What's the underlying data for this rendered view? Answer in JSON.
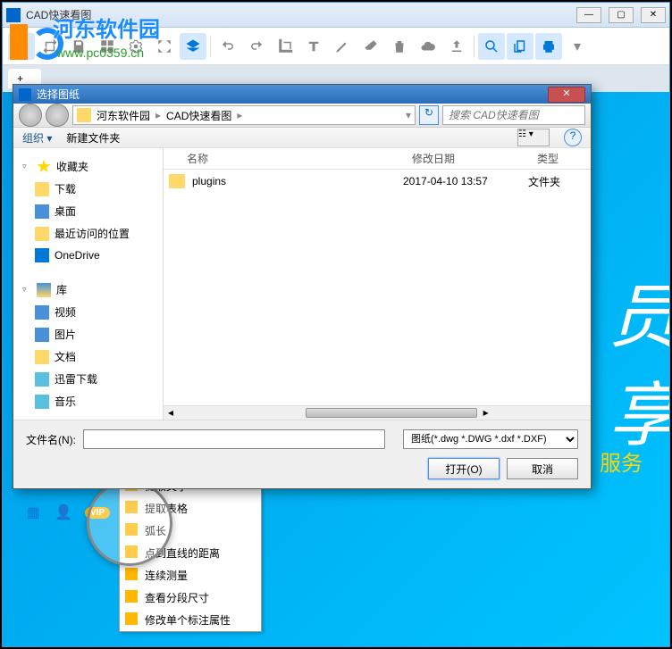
{
  "app": {
    "title": "CAD快速看图",
    "watermark_text": "河东软件园",
    "watermark_url": "www.pc0359.cn"
  },
  "win_controls": {
    "min": "—",
    "max": "▢",
    "close": "✕"
  },
  "tab": {
    "label": "+"
  },
  "promo": {
    "big1": "员",
    "big2": "享",
    "sub": "美酒 · 服务"
  },
  "bottom_bar": {
    "vip": "VIP",
    "info": "ⓘ"
  },
  "popup": {
    "items": [
      "提取文字",
      "提取表格",
      "弧长",
      "点到直线的距离",
      "连续测量",
      "查看分段尺寸",
      "修改单个标注属性"
    ]
  },
  "dialog": {
    "title": "选择图纸",
    "close": "✕",
    "breadcrumb": [
      "河东软件园",
      "CAD快速看图"
    ],
    "search_placeholder": "搜索 CAD快速看图",
    "organize": "组织 ▾",
    "new_folder": "新建文件夹",
    "view_btn": "☷ ▾",
    "help": "?",
    "sidebar": {
      "favorites": "收藏夹",
      "fav_items": [
        "下载",
        "桌面",
        "最近访问的位置",
        "OneDrive"
      ],
      "library": "库",
      "lib_items": [
        "视频",
        "图片",
        "文档",
        "迅雷下载",
        "音乐"
      ]
    },
    "columns": {
      "name": "名称",
      "date": "修改日期",
      "type": "类型"
    },
    "rows": [
      {
        "name": "plugins",
        "date": "2017-04-10 13:57",
        "type": "文件夹"
      }
    ],
    "filename_label": "文件名(N):",
    "filename_value": "",
    "filetype": "图纸(*.dwg *.DWG *.dxf *.DXF)",
    "open": "打开(O)",
    "cancel": "取消"
  }
}
